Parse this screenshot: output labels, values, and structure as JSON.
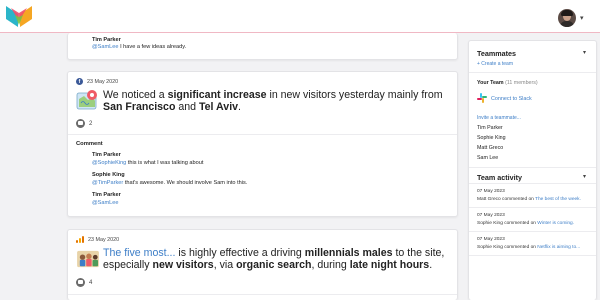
{
  "header": {
    "logo_icon": "brand-logo-icon",
    "avatar_icon": "user-avatar-icon"
  },
  "comments_top": [
    {
      "author": "Tim Parker",
      "mention": "@SamLee",
      "text": " I have a few ideas already."
    }
  ],
  "posts": [
    {
      "source_icon": "facebook-icon",
      "date": "23 May 2020",
      "headline_parts": [
        "We noticed a ",
        "significant increase",
        " in new visitors yesterday mainly from ",
        "San Francisco",
        " and ",
        "Tel Aviv",
        "."
      ],
      "comment_count": "2",
      "comment_heading": "Comment",
      "comments": [
        {
          "author": "Tim Parker",
          "mention": "@SophieKing",
          "text": " this is what I was talking about"
        },
        {
          "author": "Sophie King",
          "mention": "@TimParker",
          "text": " that's awesome. We should involve Sam into this."
        },
        {
          "author": "Tim Parker",
          "mention": "@SamLee",
          "text": ""
        }
      ]
    },
    {
      "source_icon": "google-analytics-icon",
      "date": "23 May 2020",
      "headline_parts": [
        "The five most...",
        " is highly effective a driving ",
        "millennials males",
        " to the site, especially ",
        "new visitors",
        ", via ",
        "organic search",
        ", during ",
        "late night hours",
        "."
      ],
      "comment_count": "4"
    }
  ],
  "sidebar": {
    "teammates_title": "Teammates",
    "create_team": "+ Create a team",
    "your_team_label": "Your Team",
    "members_count": "(11 members)",
    "connect_slack": "Connect to Slack",
    "invite": "Invite a teammate...",
    "members": [
      "Tim Parker",
      "Sophie King",
      "Matt Greco",
      "Sam Lee"
    ],
    "activity_title": "Team activity",
    "activity": [
      {
        "date": "07 May 2023",
        "actor": "Matt Greco commented on ",
        "target": "The best of the week."
      },
      {
        "date": "07 May 2023",
        "actor": "Sophie King commented on ",
        "target": "Winter is coming."
      },
      {
        "date": "07 May 2023",
        "actor": "Sophie King commented on ",
        "target": "Netflix is aiming to..."
      }
    ]
  },
  "colors": {
    "accent": "#3d7ec7",
    "header_border": "#f0b8c4",
    "background": "#f2f2f4"
  }
}
